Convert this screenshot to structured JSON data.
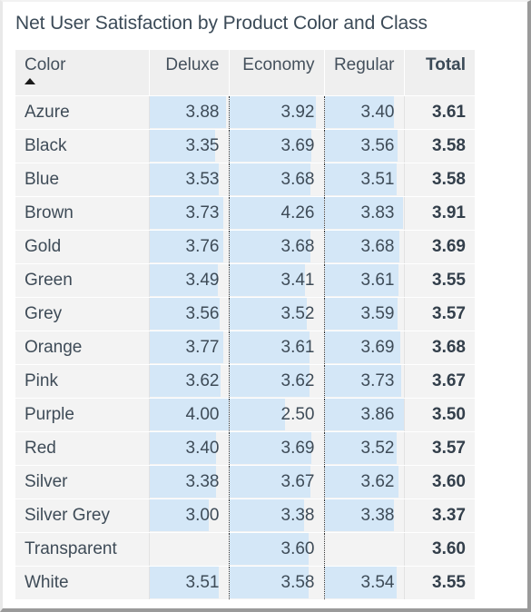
{
  "visual": {
    "title": "Net User Satisfaction by Product Color and Class",
    "type": "matrix-table"
  },
  "colors": {
    "title_text": "#3b4a57",
    "header_background": "#efefef",
    "row_background": "#f3f3f3",
    "data_bar": "#d4e7f7",
    "body_text": "#3e4b57",
    "frame_border": "#9a9a9a"
  },
  "table": {
    "sort_column": "Color",
    "sort_direction": "ascending",
    "sort_icon": "triangle-up-icon",
    "columns": [
      {
        "key": "color",
        "label": "Color",
        "align": "left",
        "bold": false,
        "bars": false
      },
      {
        "key": "deluxe",
        "label": "Deluxe",
        "align": "right",
        "bold": false,
        "bars": true
      },
      {
        "key": "economy",
        "label": "Economy",
        "align": "right",
        "bold": false,
        "bars": true
      },
      {
        "key": "regular",
        "label": "Regular",
        "align": "right",
        "bold": false,
        "bars": true
      },
      {
        "key": "total",
        "label": "Total",
        "align": "right",
        "bold": true,
        "bars": false
      }
    ]
  },
  "chart_data": {
    "type": "table",
    "title": "Net User Satisfaction by Product Color and Class",
    "xlabel": "Class",
    "ylabel": "Net User Satisfaction",
    "bar_scale": {
      "deluxe_max": 4.0,
      "economy_max": 4.26,
      "regular_max": 3.86
    },
    "categories": [
      "Azure",
      "Black",
      "Blue",
      "Brown",
      "Gold",
      "Green",
      "Grey",
      "Orange",
      "Pink",
      "Purple",
      "Red",
      "Silver",
      "Silver Grey",
      "Transparent",
      "White"
    ],
    "series": [
      {
        "name": "Deluxe",
        "values": [
          3.88,
          3.35,
          3.53,
          3.73,
          3.76,
          3.49,
          3.56,
          3.77,
          3.62,
          4.0,
          3.4,
          3.38,
          3.0,
          null,
          3.51
        ]
      },
      {
        "name": "Economy",
        "values": [
          3.92,
          3.69,
          3.68,
          4.26,
          3.68,
          3.41,
          3.52,
          3.61,
          3.62,
          2.5,
          3.69,
          3.67,
          3.38,
          3.6,
          3.58
        ]
      },
      {
        "name": "Regular",
        "values": [
          3.4,
          3.56,
          3.51,
          3.83,
          3.68,
          3.61,
          3.59,
          3.69,
          3.73,
          3.86,
          3.52,
          3.62,
          3.38,
          null,
          3.54
        ]
      },
      {
        "name": "Total",
        "values": [
          3.61,
          3.58,
          3.58,
          3.91,
          3.69,
          3.55,
          3.57,
          3.68,
          3.67,
          3.5,
          3.57,
          3.6,
          3.37,
          3.6,
          3.55
        ]
      }
    ],
    "rows": [
      {
        "color": "Azure",
        "deluxe": "3.88",
        "economy": "3.92",
        "regular": "3.40",
        "total": "3.61"
      },
      {
        "color": "Black",
        "deluxe": "3.35",
        "economy": "3.69",
        "regular": "3.56",
        "total": "3.58"
      },
      {
        "color": "Blue",
        "deluxe": "3.53",
        "economy": "3.68",
        "regular": "3.51",
        "total": "3.58"
      },
      {
        "color": "Brown",
        "deluxe": "3.73",
        "economy": "4.26",
        "regular": "3.83",
        "total": "3.91"
      },
      {
        "color": "Gold",
        "deluxe": "3.76",
        "economy": "3.68",
        "regular": "3.68",
        "total": "3.69"
      },
      {
        "color": "Green",
        "deluxe": "3.49",
        "economy": "3.41",
        "regular": "3.61",
        "total": "3.55"
      },
      {
        "color": "Grey",
        "deluxe": "3.56",
        "economy": "3.52",
        "regular": "3.59",
        "total": "3.57"
      },
      {
        "color": "Orange",
        "deluxe": "3.77",
        "economy": "3.61",
        "regular": "3.69",
        "total": "3.68"
      },
      {
        "color": "Pink",
        "deluxe": "3.62",
        "economy": "3.62",
        "regular": "3.73",
        "total": "3.67"
      },
      {
        "color": "Purple",
        "deluxe": "4.00",
        "economy": "2.50",
        "regular": "3.86",
        "total": "3.50"
      },
      {
        "color": "Red",
        "deluxe": "3.40",
        "economy": "3.69",
        "regular": "3.52",
        "total": "3.57"
      },
      {
        "color": "Silver",
        "deluxe": "3.38",
        "economy": "3.67",
        "regular": "3.62",
        "total": "3.60"
      },
      {
        "color": "Silver Grey",
        "deluxe": "3.00",
        "economy": "3.38",
        "regular": "3.38",
        "total": "3.37"
      },
      {
        "color": "Transparent",
        "deluxe": "",
        "economy": "3.60",
        "regular": "",
        "total": "3.60"
      },
      {
        "color": "White",
        "deluxe": "3.51",
        "economy": "3.58",
        "regular": "3.54",
        "total": "3.55"
      }
    ]
  }
}
